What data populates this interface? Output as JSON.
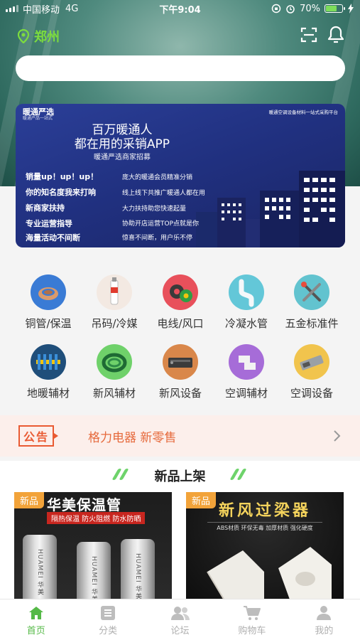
{
  "status_bar": {
    "carrier": "中国移动",
    "network": "4G",
    "time": "下午9:04",
    "battery": "70%",
    "battery_level": 0.7
  },
  "header": {
    "location": "郑州",
    "search_placeholder": ""
  },
  "banner": {
    "brand": "暖通严选",
    "brand_sub": "暖通产品一站式",
    "top_right": "暖通空调设备材料一站式采购平台",
    "headline_1": "百万暖通人",
    "headline_2": "都在用的采销APP",
    "subtitle": "暖通严选商家招募",
    "left_lines": [
      "销量up！up！up！",
      "你的知名度我来打响",
      "新商家扶持",
      "专业运营指导",
      "海量活动不间断"
    ],
    "right_lines": [
      "庞大的暖通会员精准分销",
      "线上线下共推广暖通人都在用",
      "大力扶持助您快速起量",
      "协助开店运营TOP点就是你",
      "惊喜不间断，用户乐不停"
    ]
  },
  "categories": [
    {
      "label": "铜管/保温",
      "icon": "copper-pipe-icon",
      "color": "#3a7bd5"
    },
    {
      "label": "吊码/冷媒",
      "icon": "refrigerant-icon",
      "color": "#f3e9e2"
    },
    {
      "label": "电线/风口",
      "icon": "wire-icon",
      "color": "#e8505b"
    },
    {
      "label": "冷凝水管",
      "icon": "drain-pipe-icon",
      "color": "#63c7d8"
    },
    {
      "label": "五金标准件",
      "icon": "tools-icon",
      "color": "#62c3cf"
    },
    {
      "label": "地暖辅材",
      "icon": "floor-heating-icon",
      "color": "#1f4e7a"
    },
    {
      "label": "新风辅材",
      "icon": "hose-icon",
      "color": "#6fd16a"
    },
    {
      "label": "新风设备",
      "icon": "ventilator-icon",
      "color": "#d9874a"
    },
    {
      "label": "空调辅材",
      "icon": "fitting-icon",
      "color": "#a66cd8"
    },
    {
      "label": "空调设备",
      "icon": "ac-unit-icon",
      "color": "#f1c44d"
    }
  ],
  "notice": {
    "tag": "公告",
    "text": "格力电器 新零售"
  },
  "section": {
    "title": "新品上架"
  },
  "products": [
    {
      "badge": "新品",
      "title": "华美保温管",
      "tagline": "隔热保温 防火阻燃 防水防晒",
      "pipe_text": "HUAMEI 华美"
    },
    {
      "badge": "新品",
      "title": "新风过梁器",
      "tagline": "ABS材质 环保无毒 加厚材质 强化硬度"
    }
  ],
  "tabbar": [
    {
      "label": "首页",
      "icon": "home-icon",
      "active": true
    },
    {
      "label": "分类",
      "icon": "category-icon",
      "active": false
    },
    {
      "label": "论坛",
      "icon": "forum-icon",
      "active": false
    },
    {
      "label": "购物车",
      "icon": "cart-icon",
      "active": false
    },
    {
      "label": "我的",
      "icon": "profile-icon",
      "active": false
    }
  ]
}
